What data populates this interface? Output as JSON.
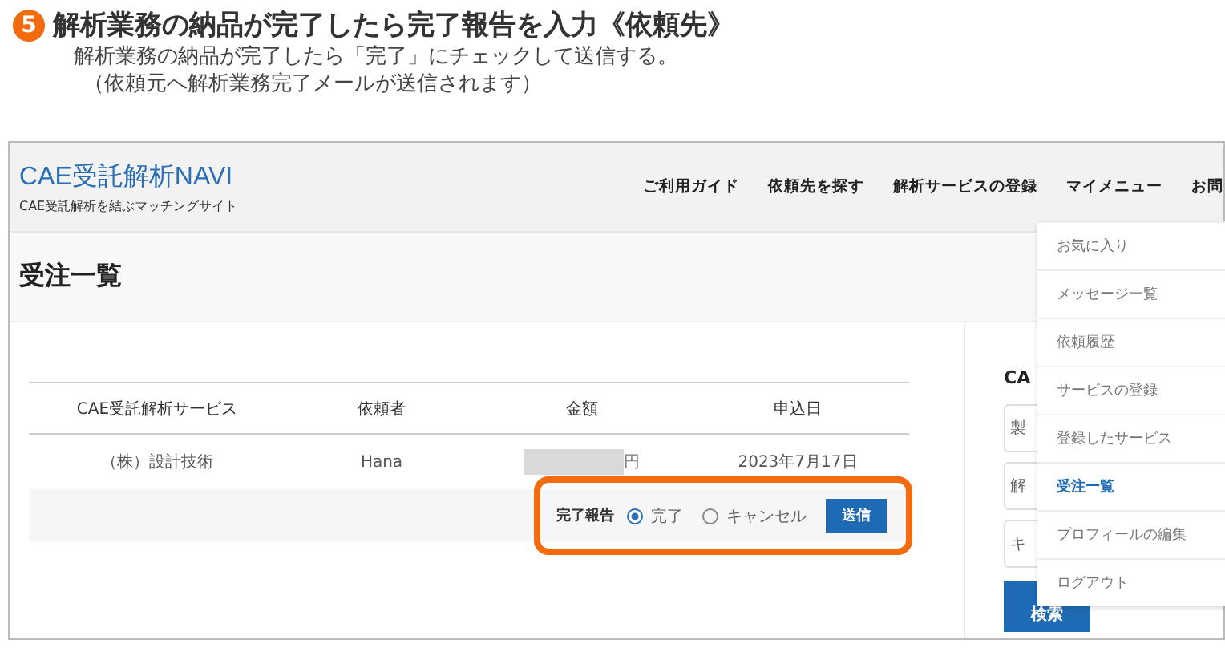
{
  "step": {
    "number": "5",
    "title": "解析業務の納品が完了したら完了報告を入力《依頼先》",
    "lines": [
      "解析業務の納品が完了したら「完了」にチェックして送信する。",
      "（依頼元へ解析業務完了メールが送信されます）"
    ]
  },
  "site": {
    "logo": "CAE受託解析NAVI",
    "tagline": "CAE受託解析を結ぶマッチングサイト",
    "nav": [
      "ご利用ガイド",
      "依頼先を探す",
      "解析サービスの登録",
      "マイメニュー",
      "お問"
    ]
  },
  "page_title": "受注一覧",
  "table": {
    "columns": [
      "CAE受託解析サービス",
      "依頼者",
      "金額",
      "申込日"
    ],
    "rows": [
      {
        "cells": [
          "（株）設計技術",
          "Hana",
          "円",
          "2023年7月17日"
        ],
        "amount_redacted": true
      }
    ],
    "report": {
      "label": "完了報告",
      "options": [
        {
          "label": "完了",
          "selected": true
        },
        {
          "label": "キャンセル",
          "selected": false
        }
      ],
      "button": "送信"
    }
  },
  "sidebar": {
    "heading": "CA",
    "fields": [
      "製",
      "解",
      "キ"
    ],
    "button": "検索"
  },
  "menu": [
    {
      "label": "お気に入り",
      "selected": false
    },
    {
      "label": "メッセージ一覧",
      "selected": false
    },
    {
      "label": "依頼履歴",
      "selected": false
    },
    {
      "label": "サービスの登録",
      "selected": false
    },
    {
      "label": "登録したサービス",
      "selected": false
    },
    {
      "label": "受注一覧",
      "selected": true
    },
    {
      "label": "プロフィールの編集",
      "selected": false
    },
    {
      "label": "ログアウト",
      "selected": false
    }
  ]
}
